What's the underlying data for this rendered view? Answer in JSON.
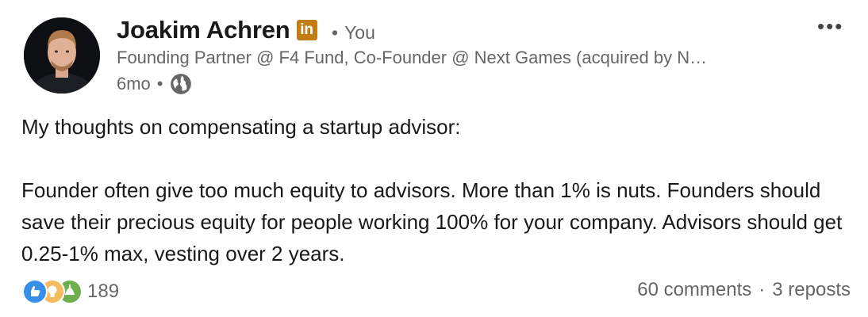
{
  "author": {
    "name": "Joakim Achren",
    "badge": "in",
    "relation": "You",
    "headline": "Founding Partner @ F4 Fund, Co-Founder @ Next Games (acquired by N…",
    "age": "6mo",
    "visibility_icon": "globe-icon"
  },
  "menu_icon": "more-options-icon",
  "post": {
    "paragraphs": [
      "My thoughts on compensating a startup advisor:",
      "Founder often give too much equity to advisors. More than 1% is nuts. Founders should save their precious equity for people working 100% for your company. Advisors should get 0.25-1% max, vesting over 2 years."
    ]
  },
  "social": {
    "reaction_icons": [
      "like-icon",
      "insightful-icon",
      "support-icon"
    ],
    "reaction_count": "189",
    "comments": "60 comments",
    "reposts": "3 reposts"
  },
  "colors": {
    "badge": "#c37d16",
    "like": "#378fe9",
    "insightful": "#f5bb5c",
    "support": "#6dae4f",
    "secondary_text": "#666666"
  }
}
